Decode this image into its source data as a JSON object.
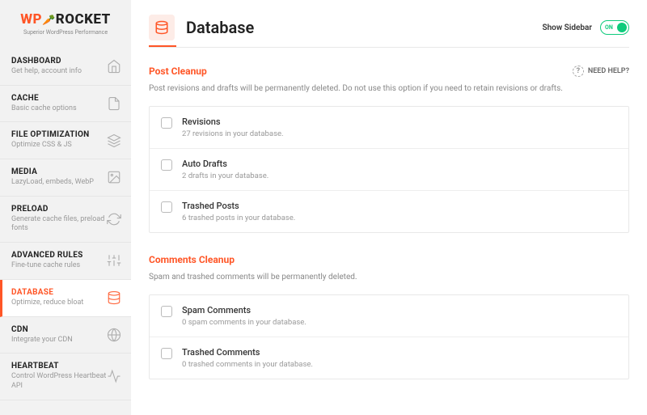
{
  "brand": {
    "wp": "WP",
    "rocket": "ROCKET",
    "tagline": "Superior WordPress Performance"
  },
  "nav": [
    {
      "title": "DASHBOARD",
      "desc": "Get help, account info",
      "icon": "home"
    },
    {
      "title": "CACHE",
      "desc": "Basic cache options",
      "icon": "file"
    },
    {
      "title": "FILE OPTIMIZATION",
      "desc": "Optimize CSS & JS",
      "icon": "layers"
    },
    {
      "title": "MEDIA",
      "desc": "LazyLoad, embeds, WebP",
      "icon": "image"
    },
    {
      "title": "PRELOAD",
      "desc": "Generate cache files, preload fonts",
      "icon": "refresh"
    },
    {
      "title": "ADVANCED RULES",
      "desc": "Fine-tune cache rules",
      "icon": "sliders"
    },
    {
      "title": "DATABASE",
      "desc": "Optimize, reduce bloat",
      "icon": "database",
      "active": true
    },
    {
      "title": "CDN",
      "desc": "Integrate your CDN",
      "icon": "globe"
    },
    {
      "title": "HEARTBEAT",
      "desc": "Control WordPress Heartbeat API",
      "icon": "heartbeat"
    }
  ],
  "header": {
    "title": "Database",
    "show_sidebar": "Show Sidebar",
    "toggle": "ON"
  },
  "need_help": "NEED HELP?",
  "sections": [
    {
      "title": "Post Cleanup",
      "desc": "Post revisions and drafts will be permanently deleted. Do not use this option if you need to retain revisions or drafts.",
      "items": [
        {
          "title": "Revisions",
          "sub": "27 revisions in your database."
        },
        {
          "title": "Auto Drafts",
          "sub": "2 drafts in your database."
        },
        {
          "title": "Trashed Posts",
          "sub": "6 trashed posts in your database."
        }
      ]
    },
    {
      "title": "Comments Cleanup",
      "desc": "Spam and trashed comments will be permanently deleted.",
      "items": [
        {
          "title": "Spam Comments",
          "sub": "0 spam comments in your database."
        },
        {
          "title": "Trashed Comments",
          "sub": "0 trashed comments in your database."
        }
      ]
    }
  ]
}
